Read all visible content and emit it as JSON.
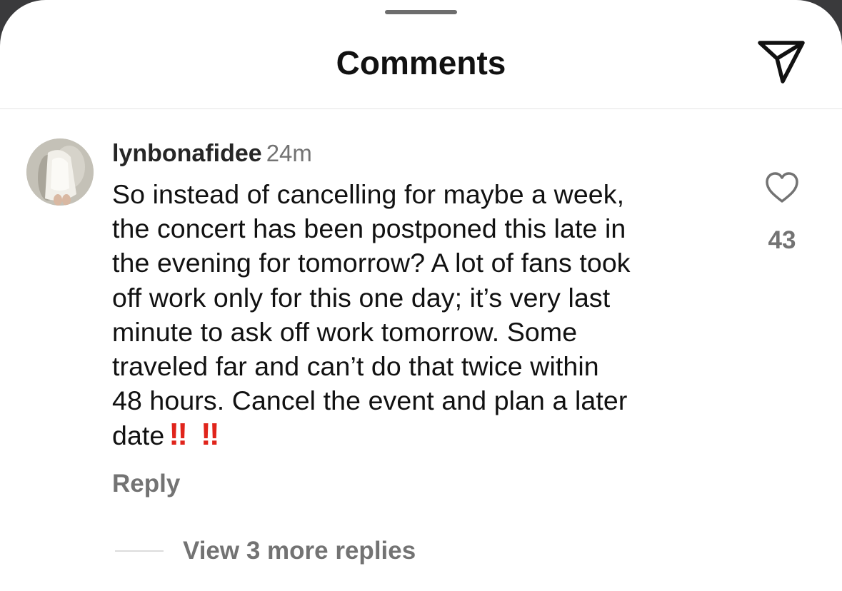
{
  "header": {
    "title": "Comments",
    "share_icon": "paper-plane-icon"
  },
  "comment": {
    "username": "lynbonafidee",
    "timestamp": "24m",
    "avatar_icon": "user-avatar",
    "lines": [
      "So instead of cancelling for maybe a week,",
      "the concert has been postponed this late in",
      "the evening for tomorrow? A lot of fans took",
      "off work only for this one day; it’s very last",
      "minute to ask off work tomorrow. Some",
      "traveled far and can’t do that twice within",
      "48 hours. Cancel the event and plan a later",
      "date"
    ],
    "emphasis": [
      "‼",
      "‼"
    ],
    "emphasis_color": "#e0241b",
    "like_count": "43",
    "like_icon": "heart-outline-icon",
    "reply_label": "Reply",
    "view_replies_label": "View 3 more replies"
  }
}
